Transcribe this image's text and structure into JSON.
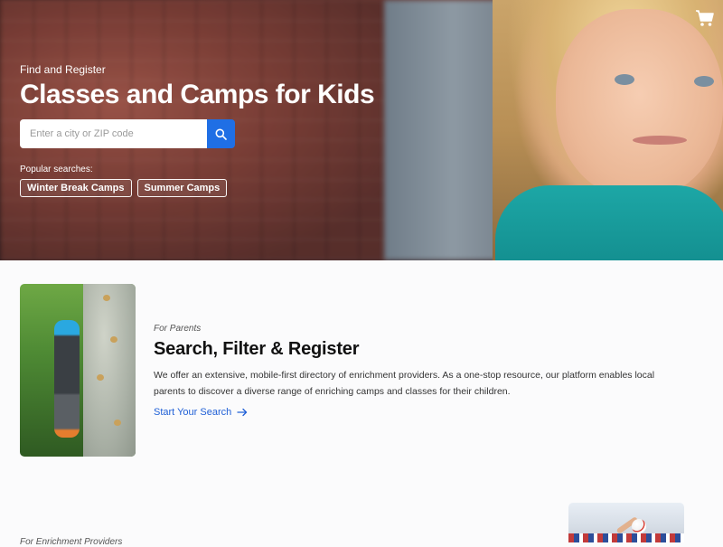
{
  "hero": {
    "eyebrow": "Find and Register",
    "title": "Classes and Camps for Kids",
    "search": {
      "placeholder": "Enter a city or ZIP code",
      "value": ""
    },
    "popular_label": "Popular searches:",
    "chips": [
      "Winter Break Camps",
      "Summer Camps"
    ]
  },
  "parents": {
    "eyebrow": "For Parents",
    "title": "Search, Filter & Register",
    "body": "We offer an extensive, mobile-first directory of enrichment providers. As a one-stop resource, our platform enables local parents to discover a diverse range of enriching camps and classes for their children.",
    "link_label": "Start Your Search"
  },
  "providers": {
    "eyebrow": "For Enrichment Providers"
  },
  "icons": {
    "cart": "cart-icon",
    "search": "search-icon",
    "arrow": "arrow-right-icon"
  },
  "colors": {
    "accent": "#1f6fe5",
    "link": "#1f5fd6"
  }
}
